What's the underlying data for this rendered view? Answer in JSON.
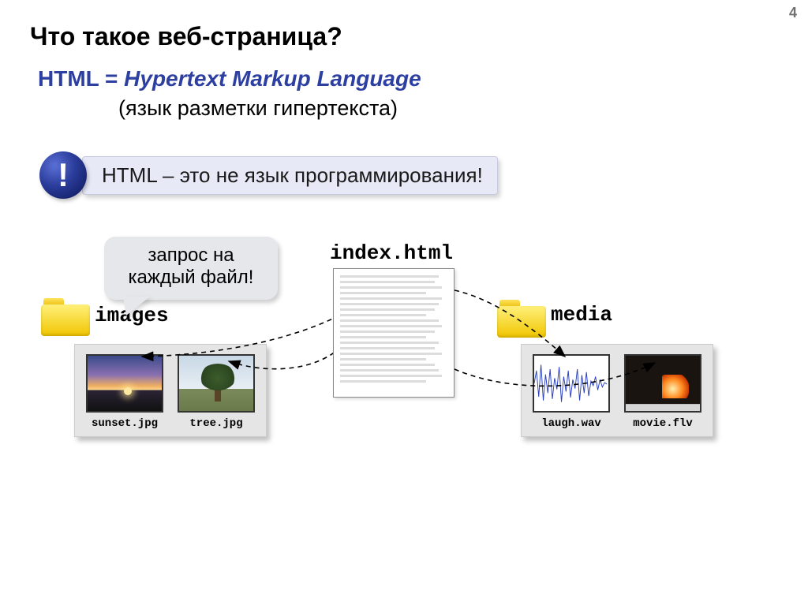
{
  "page_number": "4",
  "title": "Что такое веб-страница?",
  "subheading": {
    "prefix": "HTML = ",
    "expansion": "Hypertext Markup Language",
    "translation": "(язык разметки гипертекста)"
  },
  "callout": {
    "symbol": "!",
    "text": "HTML – это не язык программирования!"
  },
  "speech_bubble": "запрос на каждый файл!",
  "index_file": "index.html",
  "folders": {
    "images": {
      "name": "images",
      "files": [
        {
          "name": "sunset.jpg"
        },
        {
          "name": "tree.jpg"
        }
      ]
    },
    "media": {
      "name": "media",
      "files": [
        {
          "name": "laugh.wav"
        },
        {
          "name": "movie.flv"
        }
      ]
    }
  }
}
